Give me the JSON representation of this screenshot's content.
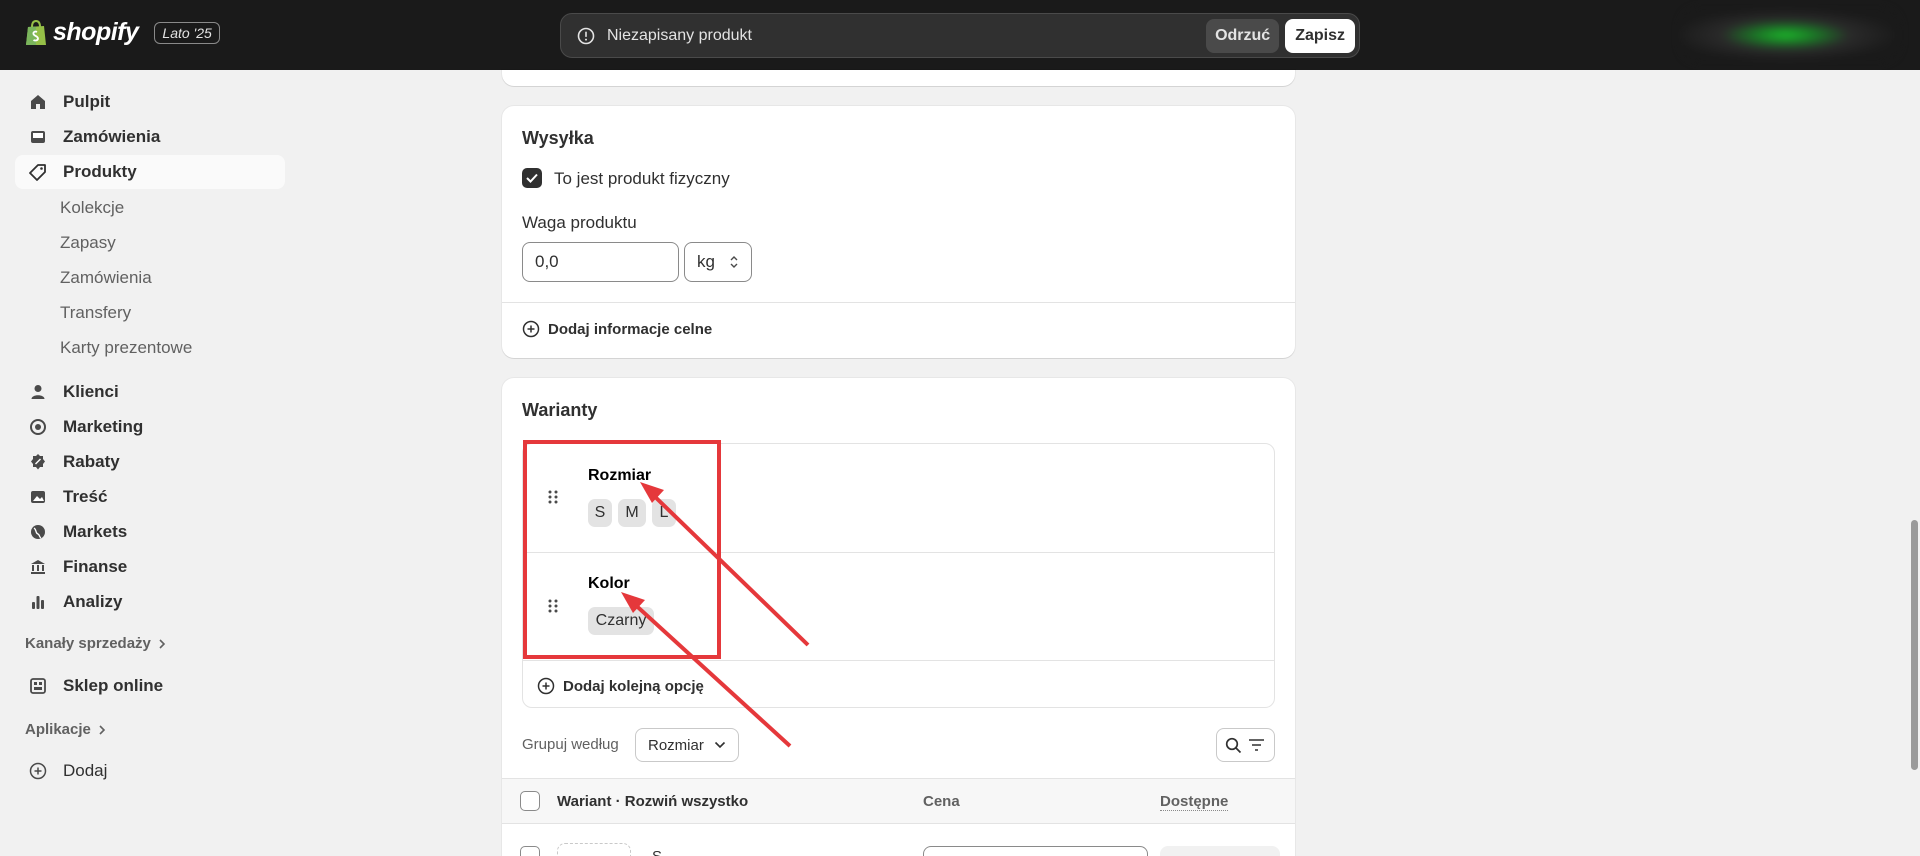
{
  "brand": {
    "name": "shopify",
    "badge": "Lato '25"
  },
  "savebar": {
    "message": "Niezapisany produkt",
    "discard": "Odrzuć",
    "save": "Zapisz"
  },
  "sidebar": {
    "items": [
      {
        "label": "Pulpit",
        "icon": "home-icon"
      },
      {
        "label": "Zamówienia",
        "icon": "inbox-icon"
      },
      {
        "label": "Produkty",
        "icon": "tag-icon",
        "active": true
      }
    ],
    "subitems": [
      "Kolekcje",
      "Zapasy",
      "Zamówienia",
      "Transfery",
      "Karty prezentowe"
    ],
    "items2": [
      {
        "label": "Klienci",
        "icon": "person-icon"
      },
      {
        "label": "Marketing",
        "icon": "target-icon"
      },
      {
        "label": "Rabaty",
        "icon": "discount-icon"
      },
      {
        "label": "Treść",
        "icon": "image-icon"
      },
      {
        "label": "Markets",
        "icon": "globe-icon"
      },
      {
        "label": "Finanse",
        "icon": "bank-icon"
      },
      {
        "label": "Analizy",
        "icon": "bar-chart-icon"
      }
    ],
    "sales_channels": "Kanały sprzedaży",
    "online_store": "Sklep online",
    "apps": "Aplikacje",
    "add": "Dodaj"
  },
  "shipping": {
    "title": "Wysyłka",
    "physical_label": "To jest produkt fizyczny",
    "weight_label": "Waga produktu",
    "weight_value": "0,0",
    "unit": "kg",
    "customs_link": "Dodaj informacje celne"
  },
  "variants": {
    "title": "Warianty",
    "options": [
      {
        "name": "Rozmiar",
        "values": [
          "S",
          "M",
          "L"
        ]
      },
      {
        "name": "Kolor",
        "values": [
          "Czarny"
        ]
      }
    ],
    "add_option": "Dodaj kolejną opcję",
    "group_by_label": "Grupuj według",
    "group_by_value": "Rozmiar",
    "table": {
      "col_variant": "Wariant · Rozwiń wszystko",
      "col_price": "Cena",
      "col_available": "Dostępne"
    },
    "first_row": "S"
  },
  "colors": {
    "annotation": "#e5383b",
    "topbar": "#1a1a1a"
  }
}
